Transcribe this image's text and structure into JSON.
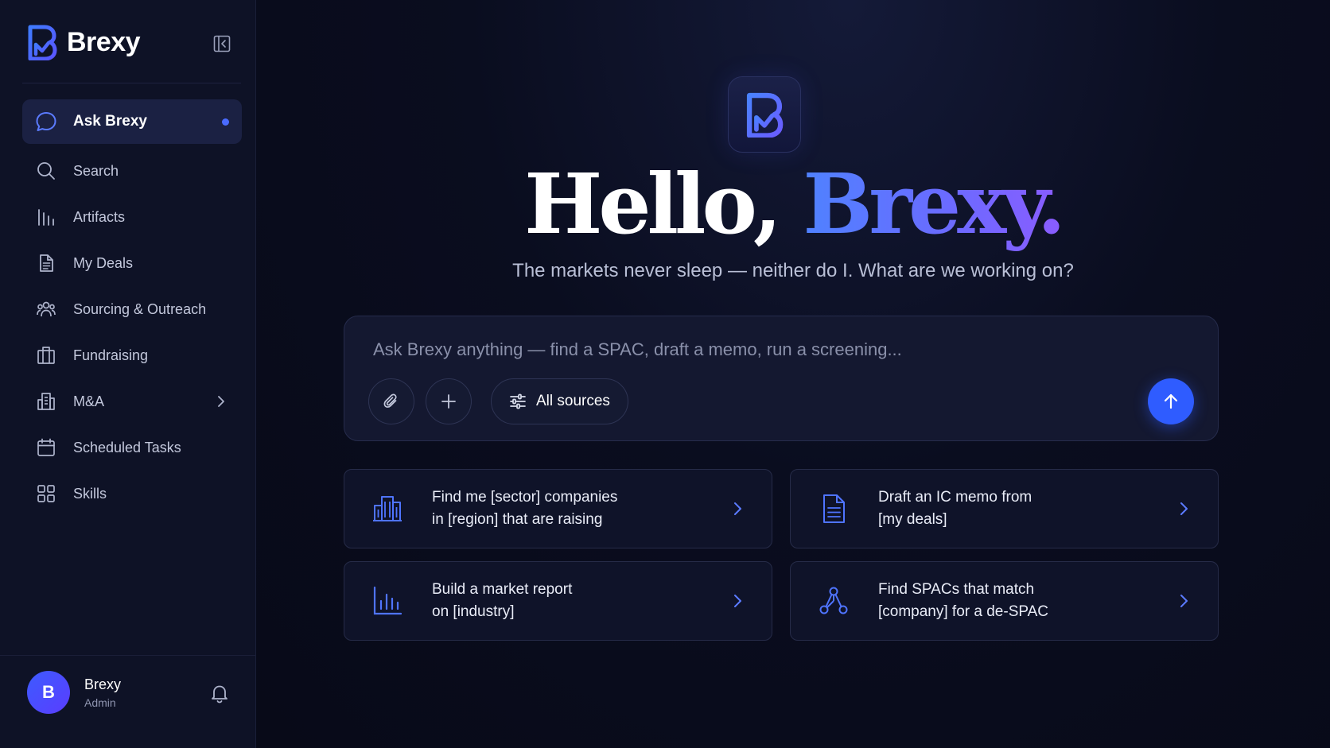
{
  "app": {
    "name": "Brexy"
  },
  "sidebar": {
    "items": [
      {
        "label": "Ask Brexy",
        "icon": "chat-bubble-icon",
        "active": true
      },
      {
        "label": "Search",
        "icon": "search-icon"
      },
      {
        "label": "Artifacts",
        "icon": "bar-chart-icon"
      },
      {
        "label": "My Deals",
        "icon": "document-icon"
      },
      {
        "label": "Sourcing & Outreach",
        "icon": "people-icon"
      },
      {
        "label": "Fundraising",
        "icon": "building-columns-icon"
      },
      {
        "label": "M&A",
        "icon": "office-building-icon",
        "has_submenu": true
      },
      {
        "label": "Scheduled Tasks",
        "icon": "calendar-icon"
      },
      {
        "label": "Skills",
        "icon": "grid-icon"
      }
    ]
  },
  "user": {
    "initial": "B",
    "name": "Brexy",
    "role": "Admin"
  },
  "hero": {
    "greeting_prefix": "Hello, ",
    "greeting_name": "Brexy.",
    "tagline": "The markets never sleep — neither do I. What are we working on?"
  },
  "composer": {
    "placeholder": "Ask Brexy anything — find a SPAC, draft a memo, run a screening...",
    "value": "",
    "sources_label": "All sources"
  },
  "suggestions": [
    {
      "line1": "Find me [sector] companies",
      "line2": "in [region] that are raising",
      "icon": "buildings-icon"
    },
    {
      "line1": "Draft an IC memo from",
      "line2": "[my deals]",
      "icon": "document-icon"
    },
    {
      "line1": "Build a market report",
      "line2": "on [industry]",
      "icon": "bar-chart-icon"
    },
    {
      "line1": "Find SPACs that match",
      "line2": "[company] for a de-SPAC",
      "icon": "network-icon"
    }
  ],
  "colors": {
    "accent": "#2f5cff",
    "active_dot": "#4a6bff",
    "background": "#080b1a",
    "sidebar": "#0e1226"
  }
}
